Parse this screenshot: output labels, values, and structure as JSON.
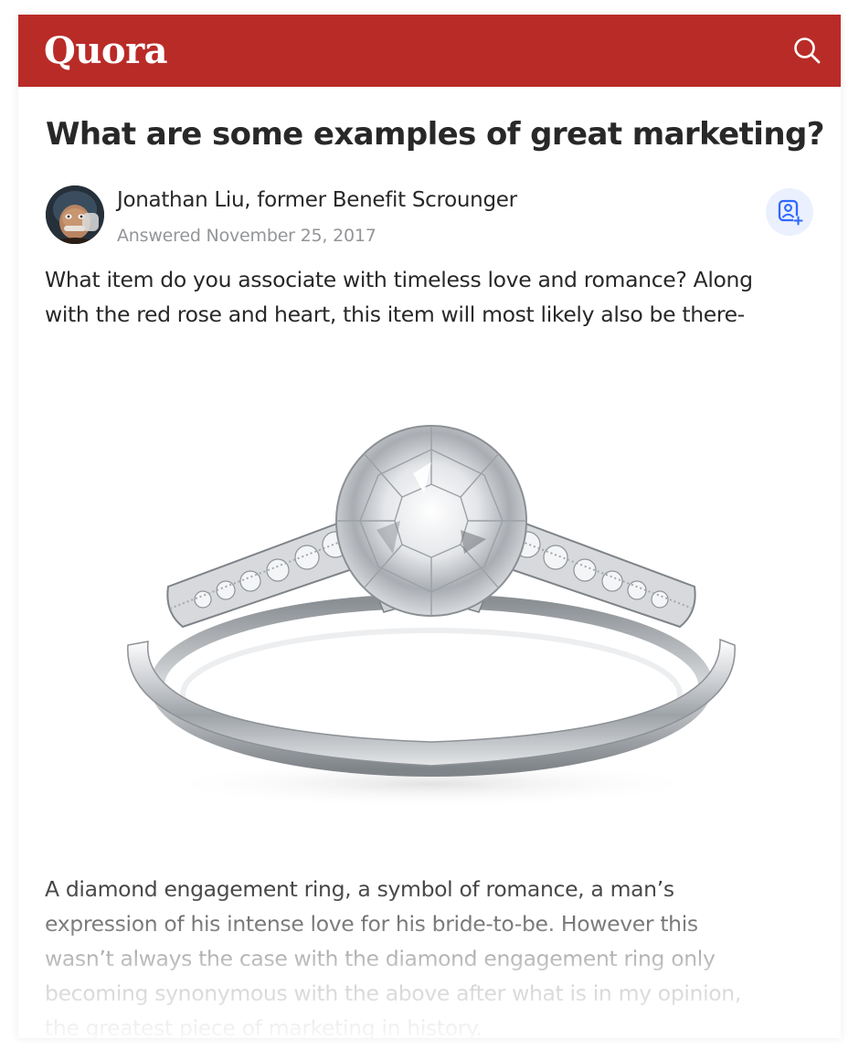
{
  "header": {
    "logo_text": "Quora",
    "brand_color": "#b92b27",
    "search_icon": "search-icon"
  },
  "question": {
    "title": "What are some examples of great marketing?"
  },
  "answer": {
    "author": "Jonathan Liu, former Benefit Scrounger",
    "date": "Answered November 25, 2017",
    "follow_icon": "add-person-icon",
    "intro_lines": [
      "What item do you associate with timeless love and romance? Along",
      "with the red rose and heart, this item will most likely also be there-"
    ],
    "image_subject": "diamond engagement ring",
    "body_lines": [
      "A diamond engagement ring, a symbol of romance, a man’s",
      "expression of his intense love for his bride-to-be. However this",
      "wasn’t always the case with the diamond engagement ring only",
      "becoming synonymous with the above after what is in my opinion,",
      "the greatest piece of marketing in history."
    ]
  }
}
